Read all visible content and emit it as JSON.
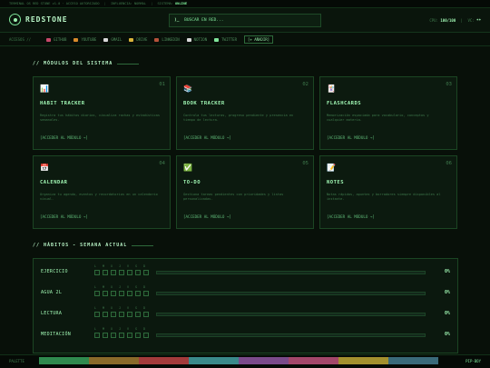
{
  "statusbar": {
    "left": "TERMINAL OS RED STONE v1.0 · ACCESO AUTORIZADO",
    "mode_label": "INFLUENCIA: NORMAL",
    "status_label": "SISTEMA:",
    "status_value": "ONLINE"
  },
  "header": {
    "brand": "REDSTONE",
    "prompt": "⟩_",
    "terminal_text": "BUSCAR EN RED...",
    "stats_label": "CPU:",
    "stats_value": "100/100",
    "stats_sep": "|",
    "stats_extra_label": "VC:",
    "stats_extra_value": "**"
  },
  "nav": {
    "label": "ACCESOS //",
    "items": [
      {
        "label": "GITHUB",
        "color": "#c7476a"
      },
      {
        "label": "YOUTUBE",
        "color": "#d98a2b"
      },
      {
        "label": "GMAIL",
        "color": "#d9d9d9"
      },
      {
        "label": "DRIVE",
        "color": "#d9b43b"
      },
      {
        "label": "LINKEDIN",
        "color": "#b5523a"
      },
      {
        "label": "NOTION",
        "color": "#d9d9d9"
      },
      {
        "label": "TWITTER",
        "color": "#7fe59a"
      },
      {
        "label": "[+ AÑADIR]",
        "color": ""
      }
    ]
  },
  "modules": {
    "title": "// MÓDULOS DEL SISTEMA",
    "cards": [
      {
        "num": "01",
        "icon": "📊",
        "icon_name": "chart-icon",
        "title": "HABIT TRACKER",
        "desc": "Registra tus hábitos diarios, visualiza rachas y estadísticas semanales.",
        "link": "[ACCEDER AL MÓDULO →]"
      },
      {
        "num": "02",
        "icon": "📚",
        "icon_name": "books-icon",
        "title": "BOOK TRACKER",
        "desc": "Controla tus lecturas, progreso pendiente y presencia en tiempo de lectura.",
        "link": "[ACCEDER AL MÓDULO →]"
      },
      {
        "num": "03",
        "icon": "🃏",
        "icon_name": "flashcard-icon",
        "title": "FLASHCARDS",
        "desc": "Memorización espaciada para vocabulario, conceptos y cualquier materia.",
        "link": "[ACCEDER AL MÓDULO →]"
      },
      {
        "num": "04",
        "icon": "📅",
        "icon_name": "calendar-icon",
        "title": "CALENDAR",
        "desc": "Organiza tu agenda, eventos y recordatorios en un calendario visual.",
        "link": "[ACCEDER AL MÓDULO →]"
      },
      {
        "num": "05",
        "icon": "✅",
        "icon_name": "checkbox-icon",
        "title": "TO-DO",
        "desc": "Gestiona tareas pendientes con prioridades y listas personalizadas.",
        "link": "[ACCEDER AL MÓDULO →]"
      },
      {
        "num": "06",
        "icon": "📝",
        "icon_name": "notes-icon",
        "title": "NOTES",
        "desc": "Notas rápidas, apuntes y borradores siempre disponibles al instante.",
        "link": "[ACCEDER AL MÓDULO →]"
      }
    ]
  },
  "habits": {
    "title": "// HÁBITOS - SEMANA ACTUAL",
    "days": [
      "L",
      "M",
      "X",
      "J",
      "V",
      "S",
      "D"
    ],
    "rows": [
      {
        "name": "EJERCICIO",
        "progress": 0,
        "pct": "0%"
      },
      {
        "name": "AGUA 2L",
        "progress": 0,
        "pct": "0%"
      },
      {
        "name": "LECTURA",
        "progress": 0,
        "pct": "0%"
      },
      {
        "name": "MEDITACIÓN",
        "progress": 0,
        "pct": "0%"
      }
    ]
  },
  "footer": {
    "left": "PALETTE",
    "swatches": [
      "#2f8a4e",
      "#8a6a2a",
      "#a33b3b",
      "#3a8a8a",
      "#7a4a8a",
      "#a3476a",
      "#a3902e",
      "#3a6a7a"
    ],
    "right": "PIP-BOY"
  }
}
